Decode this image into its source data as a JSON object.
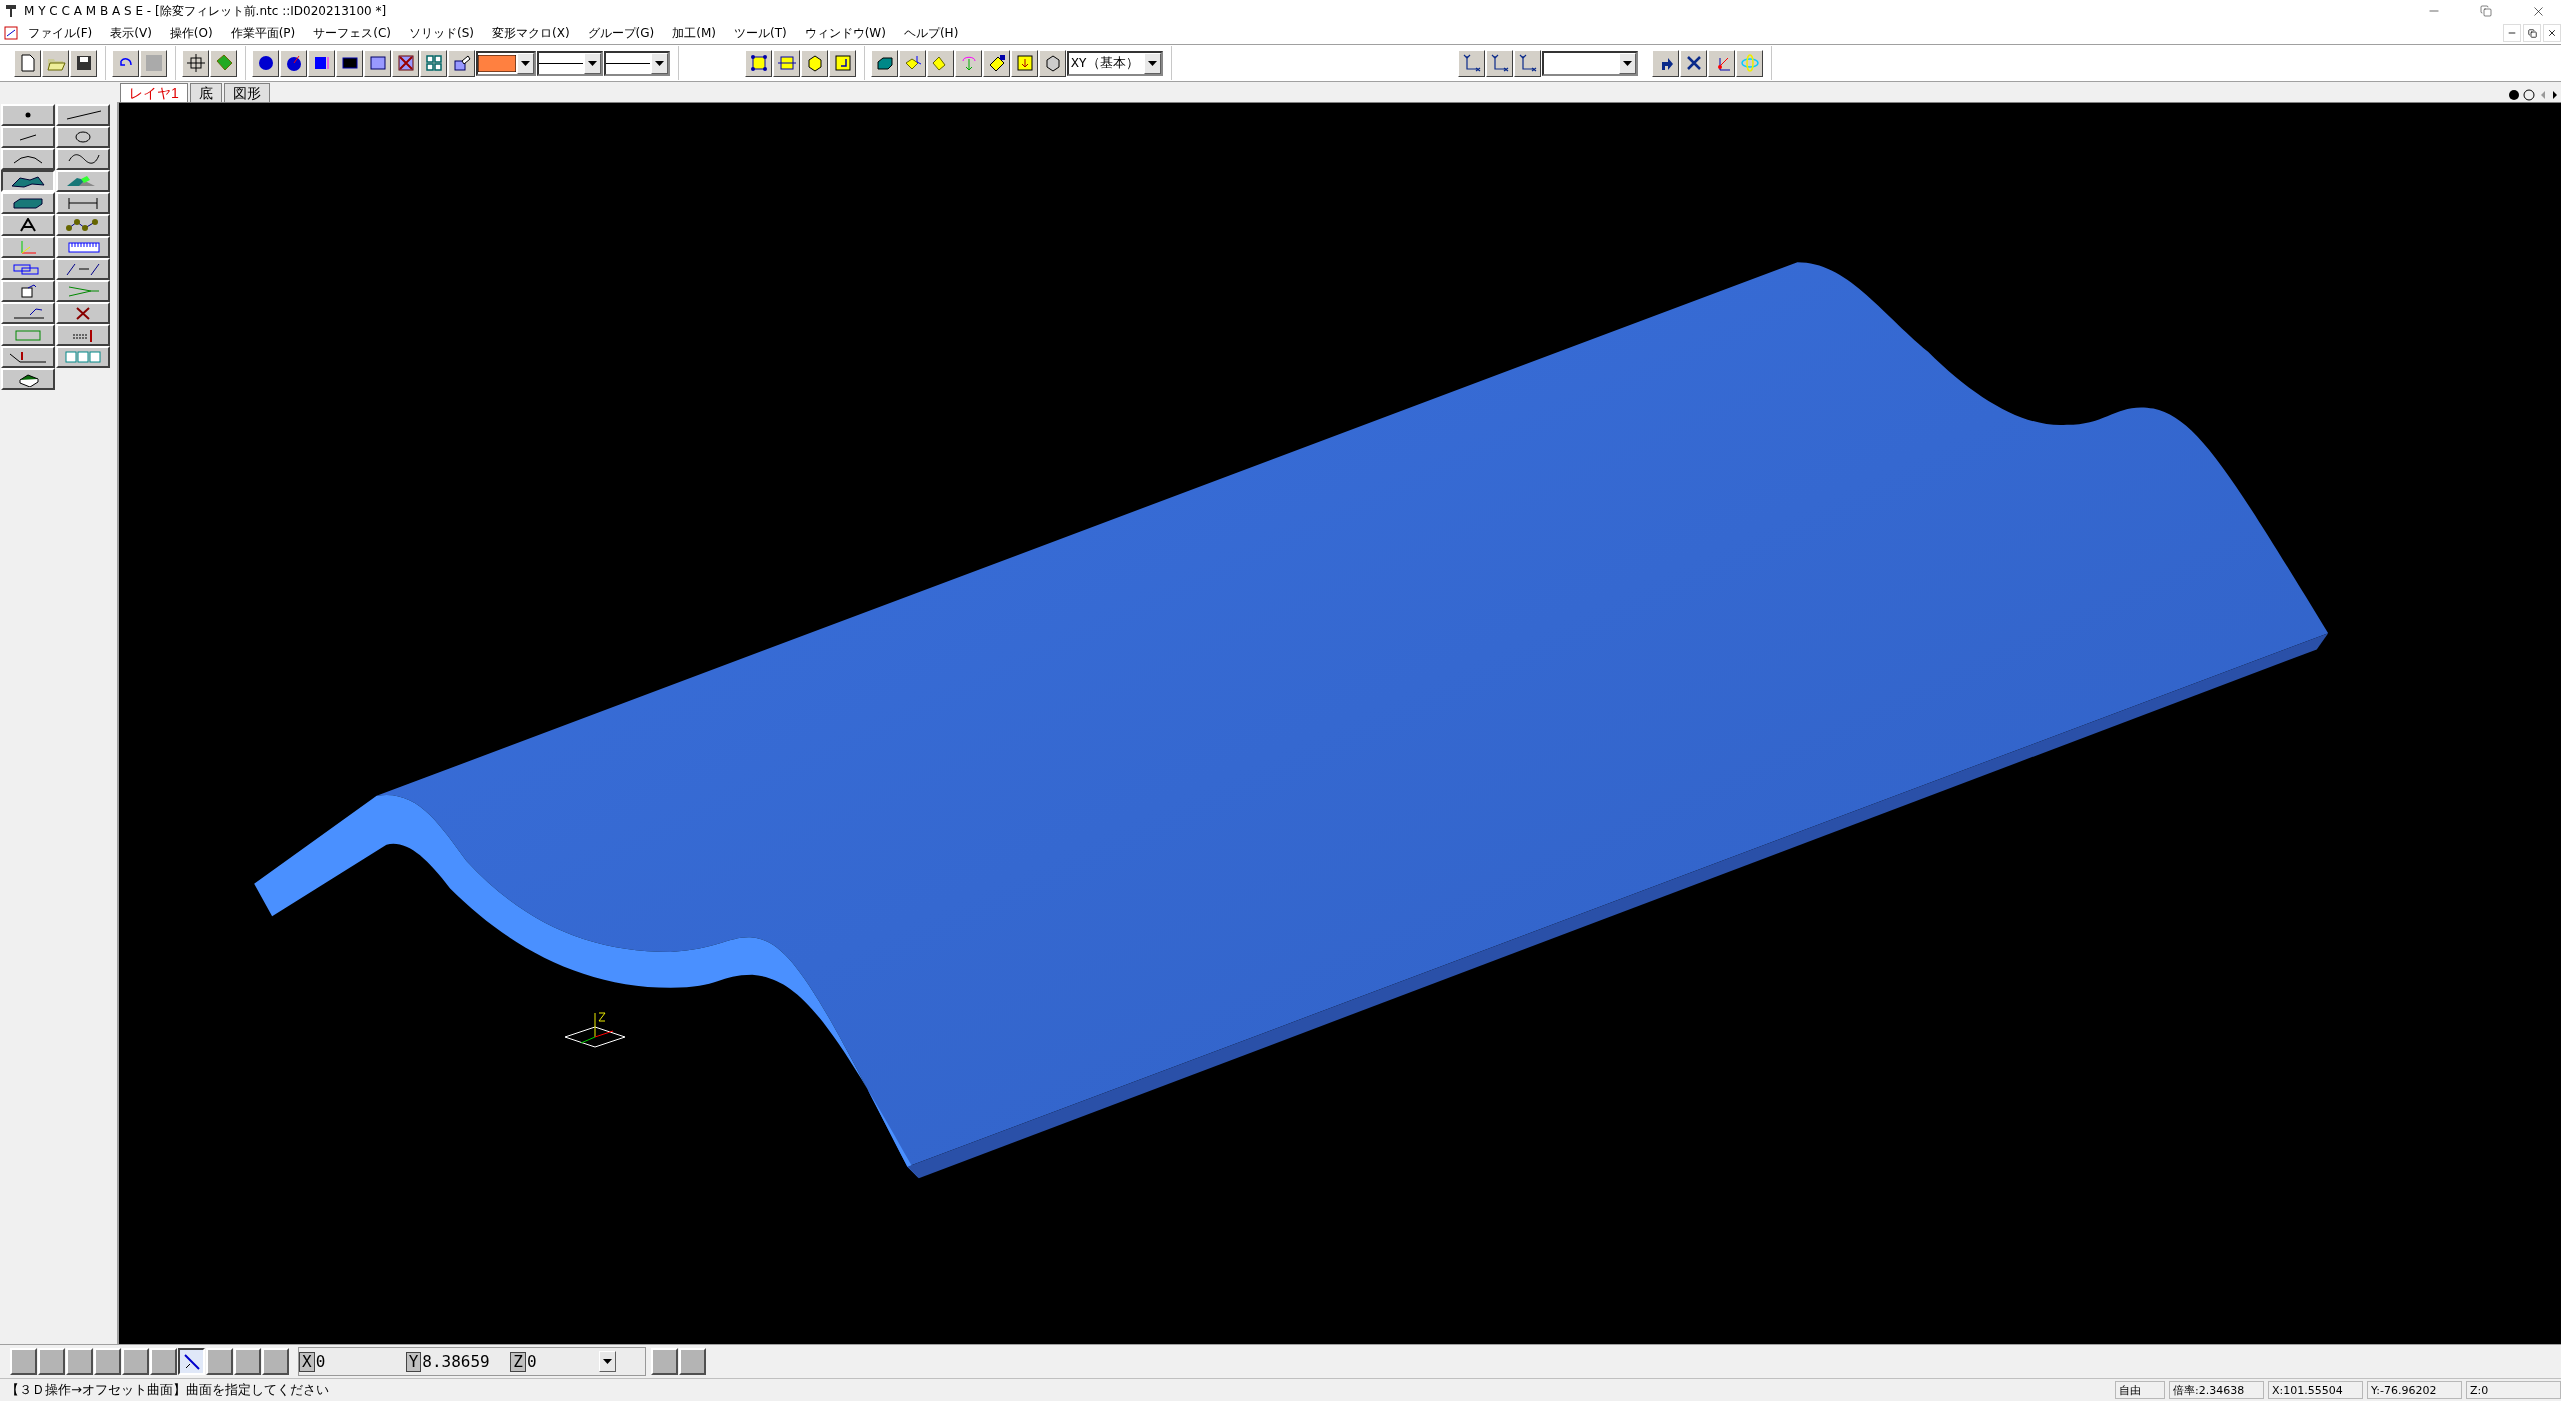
{
  "window": {
    "title": "M Y C  C A M B A S E - [除変フィレット前.ntc ::ID020213100 *]"
  },
  "menu": [
    "ファイル(F)",
    "表示(V)",
    "操作(O)",
    "作業平面(P)",
    "サーフェス(C)",
    "ソリッド(S)",
    "変形マクロ(X)",
    "グループ(G)",
    "加工(M)",
    "ツール(T)",
    "ウィンドウ(W)",
    "ヘルプ(H)"
  ],
  "toolbar": {
    "view_combo": "XY（基本）"
  },
  "tabs": [
    {
      "label": "レイヤ1",
      "selected": true
    },
    {
      "label": "底",
      "selected": false
    },
    {
      "label": "図形",
      "selected": false
    }
  ],
  "palette_tools": [
    {
      "selected": false
    },
    {
      "selected": false
    },
    {
      "selected": false
    },
    {
      "selected": false
    },
    {
      "selected": false
    },
    {
      "selected": false
    },
    {
      "selected": true
    },
    {
      "selected": false
    },
    {
      "selected": false
    },
    {
      "selected": false
    },
    {
      "selected": false
    },
    {
      "selected": false
    },
    {
      "selected": false
    },
    {
      "selected": false
    },
    {
      "selected": false
    },
    {
      "selected": false
    },
    {
      "selected": false
    },
    {
      "selected": false
    },
    {
      "selected": false
    },
    {
      "selected": false
    },
    {
      "selected": false
    },
    {
      "selected": false
    },
    {
      "selected": false
    },
    {
      "selected": false
    },
    {
      "selected": false
    }
  ],
  "snap_buttons": [
    {
      "selected": false
    },
    {
      "selected": false
    },
    {
      "selected": false
    },
    {
      "selected": false
    },
    {
      "selected": false
    },
    {
      "selected": false
    },
    {
      "selected": true
    },
    {
      "selected": false
    },
    {
      "selected": false
    },
    {
      "selected": false
    }
  ],
  "coordinates": [
    {
      "axis": "X",
      "value": "0"
    },
    {
      "axis": "Y",
      "value": "8.38659"
    },
    {
      "axis": "Z",
      "value": "0"
    }
  ],
  "status_bar": {
    "message": "【３Ｄ操作→オフセット曲面】曲面を指定してください",
    "panes": [
      "自由",
      "倍率:2.34638",
      "X:101.55504",
      "Y:-76.96202",
      "Z:0"
    ]
  }
}
